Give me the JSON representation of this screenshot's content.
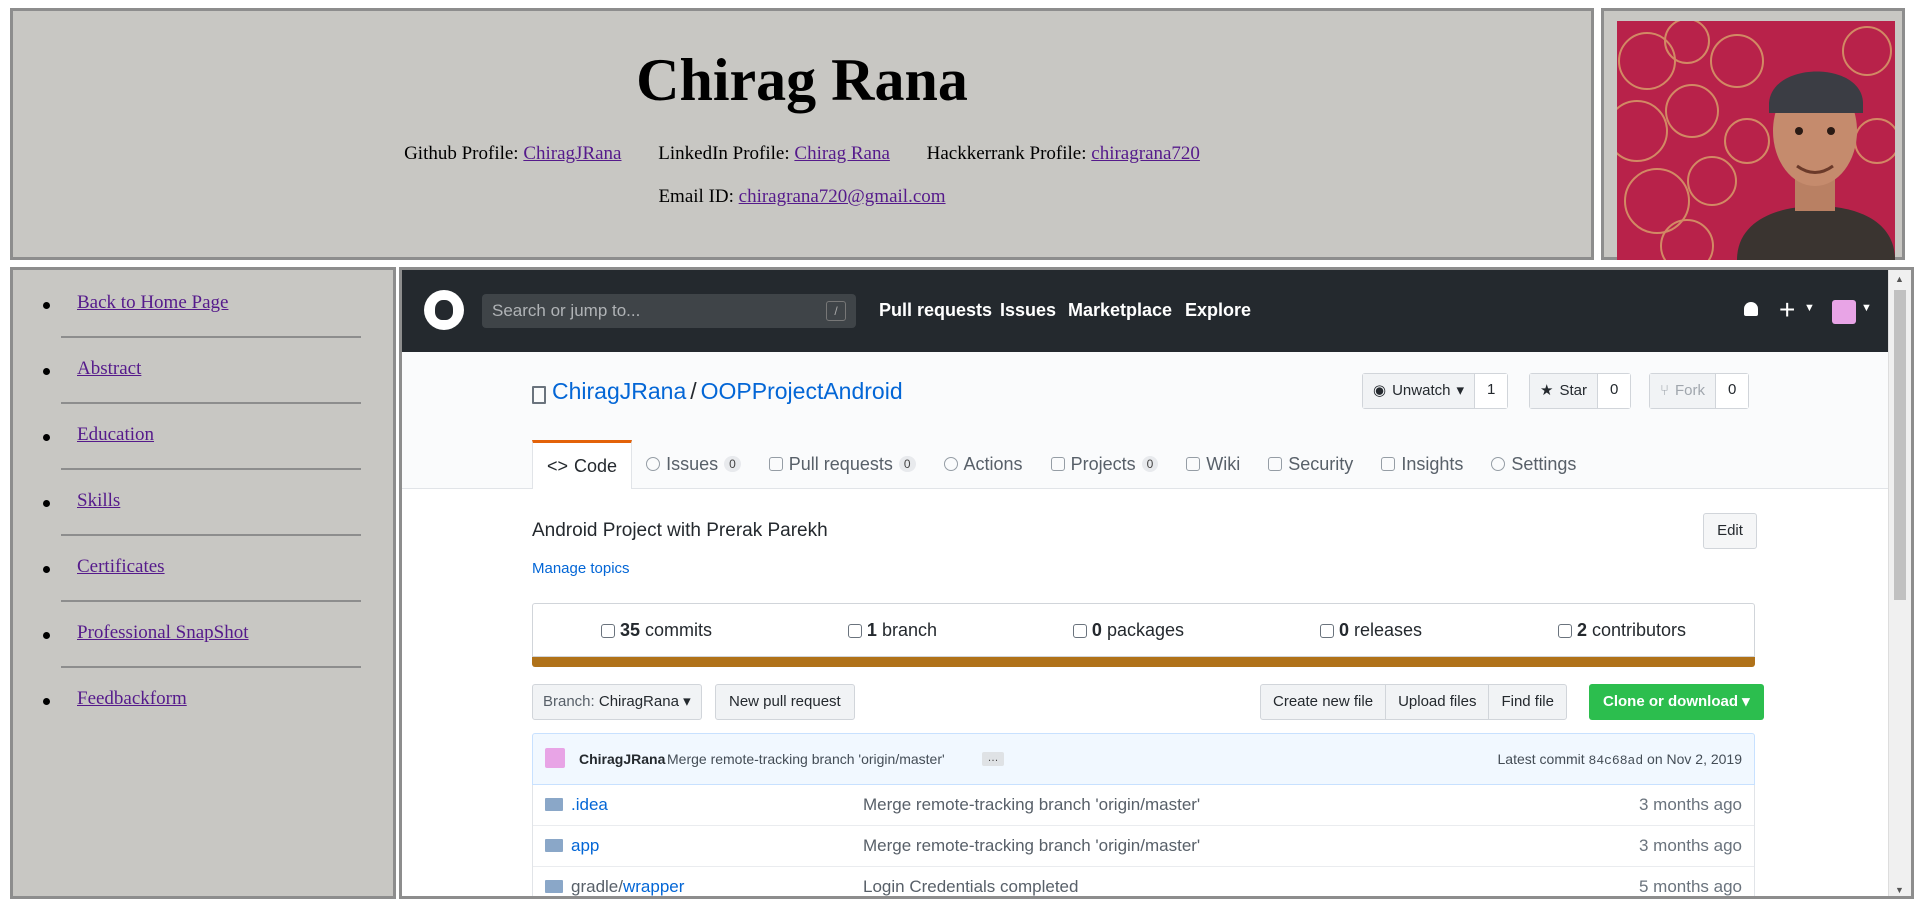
{
  "header": {
    "name": "Chirag Rana",
    "github_label": "Github Profile:",
    "github_link": "ChiragJRana",
    "linkedin_label": "LinkedIn Profile:",
    "linkedin_link": "Chirag Rana",
    "hackerrank_label": "Hackkerrank Profile:",
    "hackerrank_link": "chiragrana720",
    "email_label": "Email ID:",
    "email_link": "chiragrana720@gmail.com"
  },
  "sidebar": {
    "items": [
      {
        "label": "Back to Home Page"
      },
      {
        "label": "Abstract"
      },
      {
        "label": "Education"
      },
      {
        "label": "Skills"
      },
      {
        "label": "Certificates"
      },
      {
        "label": "Professional SnapShot"
      },
      {
        "label": "Feedbackform"
      }
    ]
  },
  "github": {
    "search_placeholder": "Search or jump to...",
    "search_shortcut": "/",
    "nav": {
      "pull_requests": "Pull requests",
      "issues": "Issues",
      "marketplace": "Marketplace",
      "explore": "Explore"
    },
    "repo": {
      "owner": "ChiragJRana",
      "separator": "/",
      "name": "OOPProjectAndroid",
      "watch_label": "Unwatch",
      "watch_count": "1",
      "star_label": "Star",
      "star_count": "0",
      "fork_label": "Fork",
      "fork_count": "0"
    },
    "tabs": [
      {
        "label": "Code",
        "badge": ""
      },
      {
        "label": "Issues",
        "badge": "0"
      },
      {
        "label": "Pull requests",
        "badge": "0"
      },
      {
        "label": "Actions",
        "badge": ""
      },
      {
        "label": "Projects",
        "badge": "0"
      },
      {
        "label": "Wiki",
        "badge": ""
      },
      {
        "label": "Security",
        "badge": ""
      },
      {
        "label": "Insights",
        "badge": ""
      },
      {
        "label": "Settings",
        "badge": ""
      }
    ],
    "description": "Android Project with Prerak Parekh",
    "edit_label": "Edit",
    "manage_topics": "Manage topics",
    "stats": {
      "commits_num": "35",
      "commits_label": "commits",
      "branch_num": "1",
      "branch_label": "branch",
      "packages_num": "0",
      "packages_label": "packages",
      "releases_num": "0",
      "releases_label": "releases",
      "contributors_num": "2",
      "contributors_label": "contributors"
    },
    "language_bar_color": "#b07219",
    "branch_key": "Branch:",
    "branch_value": "ChiragRana",
    "new_pull_request": "New pull request",
    "create_new_file": "Create new file",
    "upload_files": "Upload files",
    "find_file": "Find file",
    "clone_or_download": "Clone or download",
    "commit": {
      "author": "ChiragJRana",
      "message": "Merge remote-tracking branch 'origin/master'",
      "dots": "…",
      "latest_label": "Latest commit",
      "sha": "84c68ad",
      "date": "on Nov 2, 2019"
    },
    "files": [
      {
        "prefix": "",
        "name": ".idea",
        "message": "Merge remote-tracking branch 'origin/master'",
        "age": "3 months ago"
      },
      {
        "prefix": "",
        "name": "app",
        "message": "Merge remote-tracking branch 'origin/master'",
        "age": "3 months ago"
      },
      {
        "prefix": "gradle/",
        "name": "wrapper",
        "message": "Login Credentials completed",
        "age": "5 months ago"
      }
    ]
  }
}
